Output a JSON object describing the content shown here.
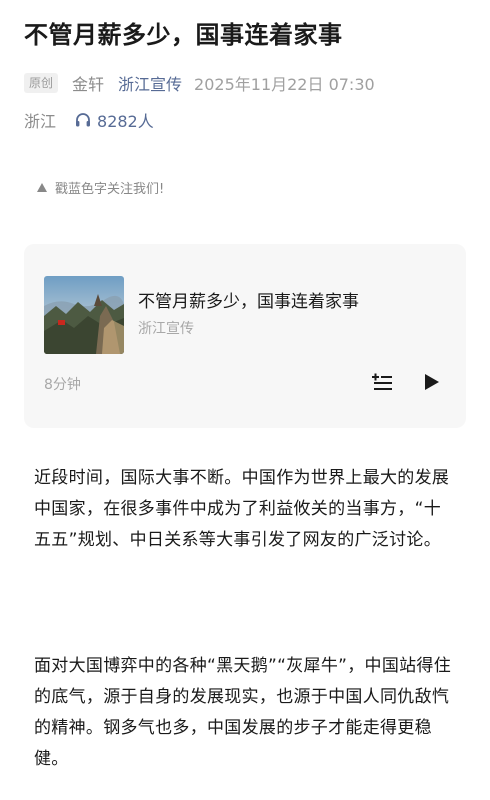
{
  "article": {
    "title": "不管月薪多少，国事连着家事",
    "badge": "原创",
    "author": "金轩",
    "account": "浙江宣传",
    "datetime": "2025年11月22日 07:30",
    "location": "浙江",
    "listeners": "8282人",
    "follow_hint": "戳蓝色字关注我们!",
    "paragraphs": [
      "近段时间，国际大事不断。中国作为世界上最大的发展中国家，在很多事件中成为了利益攸关的当事方，“十五五”规划、中日关系等大事引发了网友的广泛讨论。",
      "面对大国博弈中的各种“黑天鹅”“灰犀牛”，中国站得住的底气，源于自身的发展现实，也源于中国人同仇敌忾的精神。钢多气也多，中国发展的步子才能走得更稳健。"
    ]
  },
  "audio_card": {
    "title": "不管月薪多少，国事连着家事",
    "account": "浙江宣传",
    "duration": "8分钟",
    "icons": [
      "playlist-add-icon",
      "play-icon"
    ]
  },
  "icons": {
    "listen": "headphones-icon",
    "follow": "triangle-up-icon"
  },
  "colors": {
    "link_blue": "#576b95",
    "meta_gray": "#8c8c8c",
    "card_bg": "#f7f7f7"
  }
}
